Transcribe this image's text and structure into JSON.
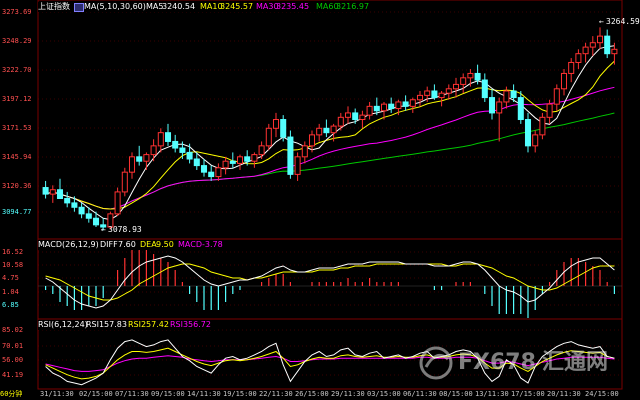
{
  "colors": {
    "background": "#000000",
    "up": "#ff3232",
    "down": "#54ffff",
    "ma5": "#ffffff",
    "ma10": "#ffff00",
    "ma30": "#ff00ff",
    "ma60": "#00c800",
    "dif": "#ffffff",
    "dea": "#ffff00",
    "macd": "#ff00ff",
    "rsi1": "#ffffff",
    "rsi2": "#ffff00",
    "rsi3": "#ff00ff",
    "grid": "#7a0000",
    "axis_text": "#c8c8c8"
  },
  "price_panel": {
    "title": "上证指数",
    "icon": "legend-toggle-icon",
    "ma_params": "MA(5,10,30,60)",
    "ma5_label": "MA5",
    "ma5_value": "3240.54",
    "ma10_label": "MA10",
    "ma10_value": "3245.57",
    "ma30_label": "MA30",
    "ma30_value": "3235.45",
    "ma60_label": "MA60",
    "ma60_value": "3216.97",
    "high_annotation": "3264.59",
    "low_annotation": "3078.93",
    "y_ticks": [
      "3273.69",
      "3248.29",
      "3222.70",
      "3197.12",
      "3171.53",
      "3145.94",
      "3120.36",
      "3094.77"
    ]
  },
  "macd_panel": {
    "label": "MACD(26,12,9)",
    "dif_label": "DIFF",
    "dif_value": "7.60",
    "dea_label": "DEA",
    "dea_value": "9.50",
    "macd_label": "MACD",
    "macd_value": "-3.78",
    "y_ticks": [
      "16.52",
      "10.58",
      "4.75",
      "1.04",
      "6.85"
    ]
  },
  "rsi_panel": {
    "label": "RSI(6,12,24)",
    "rsi1_label": "RSI1",
    "rsi1_value": "57.83",
    "rsi2_label": "RSI2",
    "rsi2_value": "57.42",
    "rsi3_label": "RSI3",
    "rsi3_value": "56.72",
    "y_ticks": [
      "85.02",
      "70.01",
      "56.00",
      "41.19"
    ]
  },
  "period_label": "60分钟",
  "x_labels": [
    "31/11:30",
    "02/15:00",
    "07/11:30",
    "09/15:00",
    "14/11:30",
    "19/15:00",
    "22/11:30",
    "26/15:00",
    "29/11:30",
    "03/15:00",
    "06/11:30",
    "08/15:00",
    "13/11:30",
    "17/15:00",
    "20/11:30",
    "24/15:00"
  ],
  "watermark": {
    "brand_latin": "FX678",
    "brand_cn": "汇通网"
  },
  "chart_data": {
    "type": "candlestick",
    "title": "上证指数",
    "interval": "60分钟",
    "price_ylim": [
      3072,
      3278
    ],
    "last_ma": {
      "MA5": 3240.54,
      "MA10": 3245.57,
      "MA30": 3235.45,
      "MA60": 3216.97
    },
    "extreme_high": 3264.59,
    "extreme_low": 3078.93,
    "candles": [
      [
        3118,
        3124,
        3108,
        3112
      ],
      [
        3112,
        3120,
        3104,
        3116
      ],
      [
        3116,
        3126,
        3110,
        3108
      ],
      [
        3108,
        3114,
        3100,
        3104
      ],
      [
        3104,
        3110,
        3096,
        3100
      ],
      [
        3100,
        3104,
        3090,
        3094
      ],
      [
        3094,
        3100,
        3086,
        3090
      ],
      [
        3090,
        3096,
        3082,
        3084
      ],
      [
        3084,
        3090,
        3079,
        3082
      ],
      [
        3082,
        3096,
        3080,
        3094
      ],
      [
        3094,
        3118,
        3092,
        3114
      ],
      [
        3114,
        3136,
        3110,
        3132
      ],
      [
        3132,
        3150,
        3126,
        3146
      ],
      [
        3146,
        3156,
        3138,
        3142
      ],
      [
        3142,
        3150,
        3134,
        3148
      ],
      [
        3148,
        3162,
        3142,
        3156
      ],
      [
        3156,
        3172,
        3150,
        3168
      ],
      [
        3168,
        3176,
        3156,
        3160
      ],
      [
        3160,
        3166,
        3150,
        3154
      ],
      [
        3154,
        3160,
        3144,
        3150
      ],
      [
        3150,
        3158,
        3140,
        3144
      ],
      [
        3144,
        3150,
        3134,
        3138
      ],
      [
        3138,
        3144,
        3128,
        3132
      ],
      [
        3132,
        3138,
        3124,
        3128
      ],
      [
        3128,
        3140,
        3124,
        3136
      ],
      [
        3136,
        3146,
        3130,
        3142
      ],
      [
        3142,
        3150,
        3136,
        3140
      ],
      [
        3140,
        3148,
        3134,
        3146
      ],
      [
        3146,
        3152,
        3138,
        3142
      ],
      [
        3142,
        3150,
        3136,
        3148
      ],
      [
        3148,
        3160,
        3144,
        3156
      ],
      [
        3156,
        3176,
        3152,
        3172
      ],
      [
        3172,
        3186,
        3164,
        3180
      ],
      [
        3180,
        3184,
        3160,
        3164
      ],
      [
        3164,
        3170,
        3126,
        3130
      ],
      [
        3130,
        3150,
        3124,
        3146
      ],
      [
        3146,
        3160,
        3140,
        3156
      ],
      [
        3156,
        3170,
        3150,
        3166
      ],
      [
        3166,
        3176,
        3160,
        3172
      ],
      [
        3172,
        3180,
        3164,
        3168
      ],
      [
        3168,
        3176,
        3160,
        3174
      ],
      [
        3174,
        3186,
        3170,
        3182
      ],
      [
        3182,
        3192,
        3176,
        3186
      ],
      [
        3186,
        3190,
        3176,
        3180
      ],
      [
        3180,
        3188,
        3172,
        3184
      ],
      [
        3184,
        3196,
        3180,
        3192
      ],
      [
        3192,
        3200,
        3184,
        3188
      ],
      [
        3188,
        3196,
        3180,
        3194
      ],
      [
        3194,
        3200,
        3186,
        3190
      ],
      [
        3190,
        3198,
        3184,
        3196
      ],
      [
        3196,
        3202,
        3188,
        3192
      ],
      [
        3192,
        3200,
        3186,
        3198
      ],
      [
        3198,
        3206,
        3192,
        3202
      ],
      [
        3202,
        3210,
        3196,
        3206
      ],
      [
        3206,
        3212,
        3198,
        3200
      ],
      [
        3200,
        3206,
        3192,
        3204
      ],
      [
        3204,
        3212,
        3198,
        3208
      ],
      [
        3208,
        3218,
        3200,
        3212
      ],
      [
        3212,
        3222,
        3204,
        3218
      ],
      [
        3218,
        3226,
        3210,
        3222
      ],
      [
        3222,
        3230,
        3212,
        3216
      ],
      [
        3216,
        3222,
        3196,
        3200
      ],
      [
        3200,
        3208,
        3180,
        3186
      ],
      [
        3186,
        3200,
        3160,
        3196
      ],
      [
        3196,
        3210,
        3190,
        3206
      ],
      [
        3206,
        3212,
        3196,
        3200
      ],
      [
        3200,
        3206,
        3176,
        3180
      ],
      [
        3180,
        3186,
        3150,
        3156
      ],
      [
        3156,
        3170,
        3150,
        3166
      ],
      [
        3166,
        3186,
        3162,
        3182
      ],
      [
        3182,
        3198,
        3176,
        3194
      ],
      [
        3194,
        3212,
        3188,
        3208
      ],
      [
        3208,
        3226,
        3202,
        3222
      ],
      [
        3222,
        3236,
        3214,
        3232
      ],
      [
        3232,
        3244,
        3226,
        3240
      ],
      [
        3240,
        3250,
        3232,
        3246
      ],
      [
        3246,
        3256,
        3238,
        3250
      ],
      [
        3250,
        3264,
        3244,
        3256
      ],
      [
        3256,
        3262,
        3236,
        3240
      ],
      [
        3240,
        3250,
        3230,
        3244
      ]
    ],
    "macd": {
      "dif": [
        4,
        2,
        -1,
        -4,
        -7,
        -9,
        -10,
        -11,
        -10,
        -7,
        -2,
        3,
        7,
        10,
        12,
        13,
        14,
        15,
        14,
        12,
        9,
        6,
        3,
        1,
        0,
        1,
        2,
        3,
        3,
        4,
        5,
        7,
        9,
        10,
        8,
        7,
        7,
        8,
        9,
        9,
        9,
        10,
        11,
        11,
        11,
        12,
        12,
        12,
        12,
        12,
        11,
        11,
        11,
        11,
        10,
        10,
        10,
        11,
        12,
        12,
        11,
        8,
        4,
        0,
        -2,
        -3,
        -5,
        -8,
        -7,
        -4,
        -1,
        3,
        7,
        10,
        12,
        13,
        14,
        14,
        11,
        8
      ],
      "dea": [
        5,
        4,
        3,
        1,
        -1,
        -3,
        -5,
        -6,
        -7,
        -7,
        -6,
        -4,
        -2,
        1,
        3,
        5,
        7,
        9,
        10,
        11,
        11,
        10,
        9,
        7,
        6,
        5,
        4,
        4,
        3,
        4,
        4,
        5,
        6,
        7,
        7,
        7,
        7,
        7,
        8,
        8,
        8,
        9,
        9,
        10,
        10,
        10,
        11,
        11,
        11,
        11,
        11,
        11,
        11,
        11,
        11,
        11,
        10,
        10,
        11,
        11,
        11,
        10,
        9,
        7,
        5,
        4,
        2,
        0,
        -1,
        -2,
        -2,
        -1,
        1,
        3,
        5,
        7,
        9,
        10,
        10,
        10
      ]
    },
    "rsi": {
      "rsi1": [
        48,
        40,
        36,
        30,
        28,
        26,
        30,
        34,
        40,
        56,
        70,
        78,
        80,
        76,
        72,
        74,
        78,
        80,
        70,
        60,
        55,
        48,
        44,
        40,
        50,
        58,
        60,
        56,
        58,
        62,
        66,
        72,
        76,
        50,
        30,
        42,
        54,
        62,
        66,
        60,
        62,
        68,
        70,
        62,
        60,
        64,
        66,
        58,
        60,
        62,
        58,
        60,
        64,
        66,
        58,
        60,
        62,
        66,
        68,
        66,
        58,
        40,
        30,
        36,
        56,
        50,
        34,
        28,
        48,
        60,
        66,
        72,
        76,
        78,
        74,
        72,
        70,
        72,
        60,
        58
      ],
      "rsi2": [
        50,
        46,
        42,
        38,
        35,
        33,
        34,
        36,
        40,
        48,
        56,
        62,
        66,
        66,
        65,
        66,
        68,
        70,
        66,
        62,
        58,
        54,
        51,
        49,
        52,
        55,
        56,
        55,
        56,
        58,
        60,
        63,
        66,
        58,
        48,
        50,
        54,
        57,
        59,
        58,
        58,
        61,
        62,
        60,
        59,
        60,
        61,
        59,
        59,
        60,
        59,
        59,
        61,
        62,
        59,
        59,
        60,
        62,
        63,
        62,
        59,
        52,
        46,
        46,
        52,
        51,
        46,
        42,
        48,
        54,
        58,
        62,
        65,
        67,
        66,
        65,
        64,
        65,
        60,
        58
      ],
      "rsi3": [
        51,
        49,
        47,
        45,
        43,
        42,
        42,
        43,
        44,
        48,
        52,
        55,
        57,
        58,
        58,
        59,
        60,
        61,
        60,
        59,
        57,
        56,
        55,
        54,
        55,
        56,
        56,
        56,
        56,
        57,
        58,
        59,
        60,
        58,
        54,
        54,
        55,
        56,
        57,
        57,
        57,
        58,
        58,
        58,
        58,
        58,
        58,
        58,
        58,
        58,
        58,
        58,
        59,
        59,
        58,
        58,
        58,
        59,
        59,
        59,
        58,
        55,
        52,
        52,
        54,
        53,
        51,
        49,
        51,
        53,
        55,
        57,
        58,
        59,
        59,
        59,
        59,
        59,
        58,
        57
      ]
    }
  }
}
